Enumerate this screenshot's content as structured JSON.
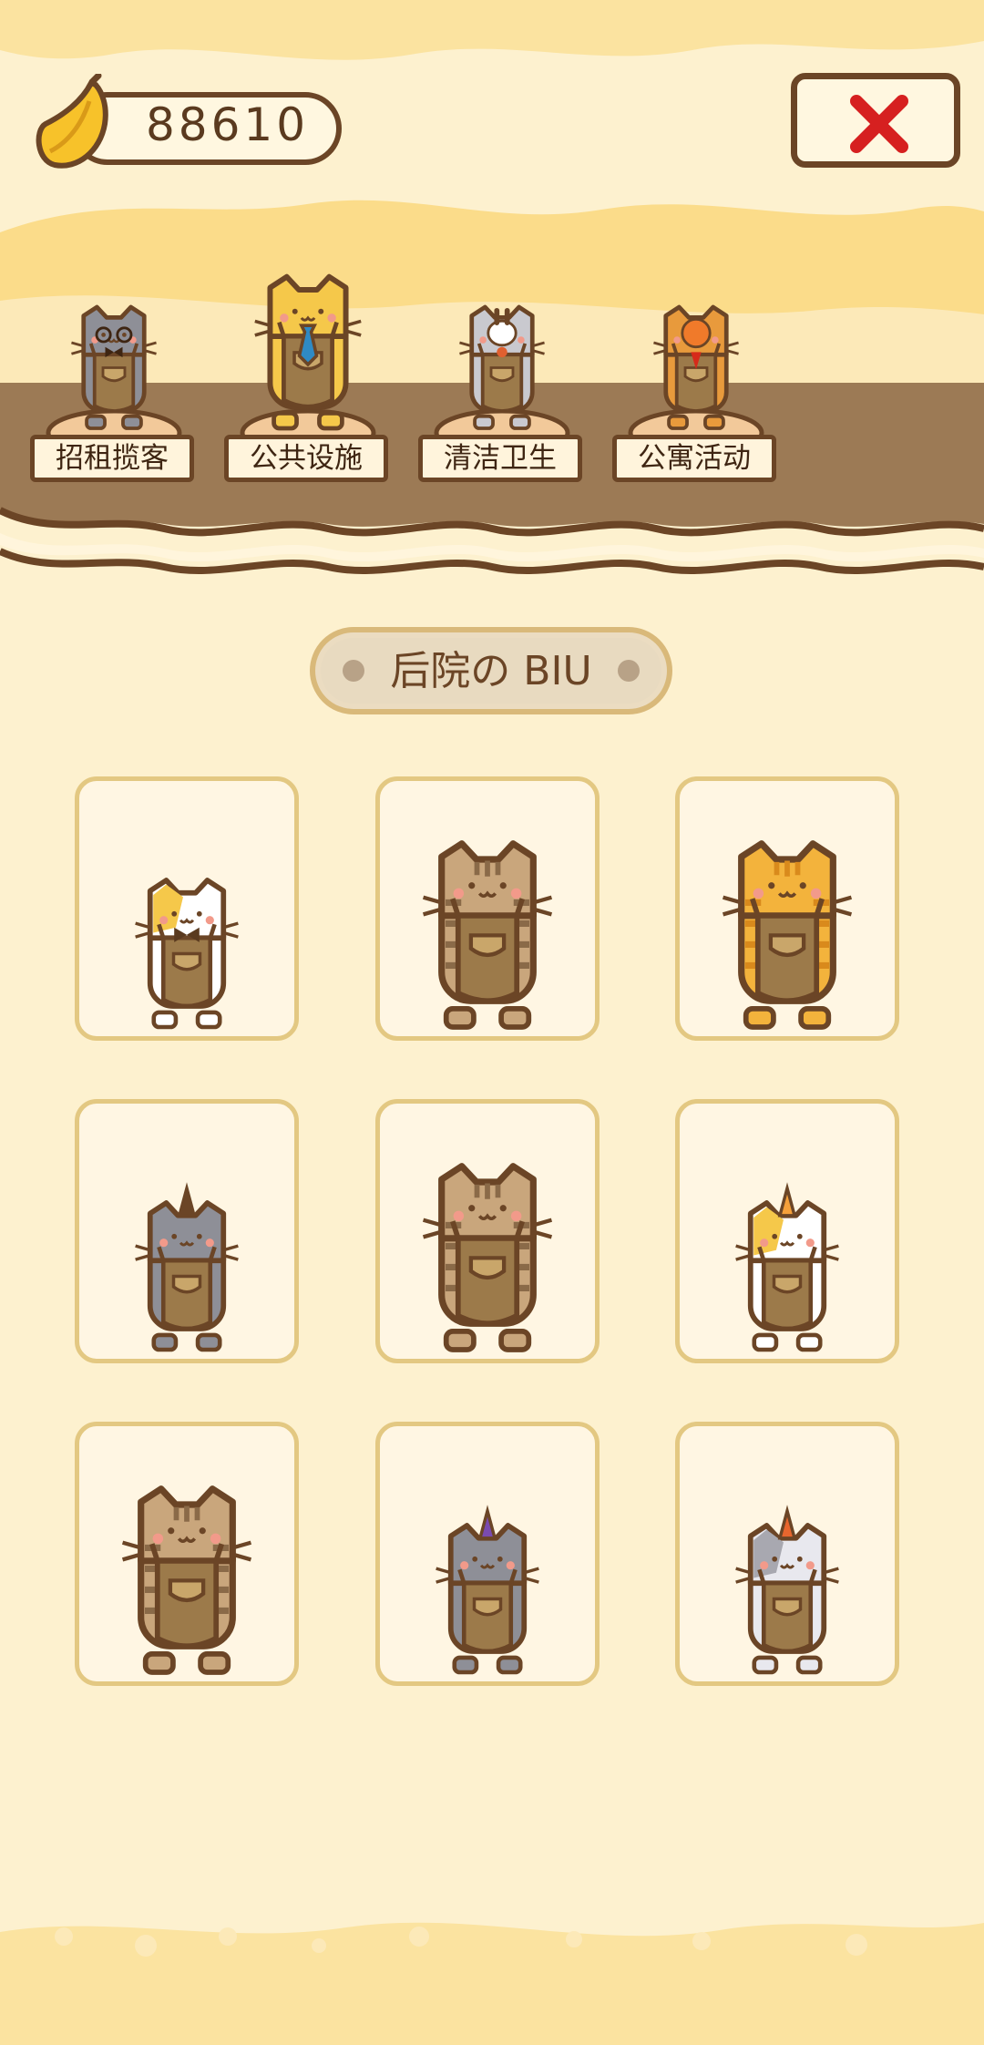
{
  "header": {
    "currency_amount": "88610",
    "currency_icon": "banana-icon",
    "close_icon": "close-icon"
  },
  "departments": [
    {
      "label": "招租揽客",
      "cat": "gray-cat-glasses"
    },
    {
      "label": "公共设施",
      "cat": "yellow-cat-tie"
    },
    {
      "label": "清洁卫生",
      "cat": "white-rabbit-cat"
    },
    {
      "label": "公寓活动",
      "cat": "orange-chick-cat"
    }
  ],
  "section": {
    "title": "后院の BIU"
  },
  "cats": [
    {
      "name": "calico-cat-bowtie"
    },
    {
      "name": "brown-tabby-cat"
    },
    {
      "name": "orange-tabby-cat"
    },
    {
      "name": "gray-cat-horn"
    },
    {
      "name": "brown-tabby-cat"
    },
    {
      "name": "calico-cat-unicorn"
    },
    {
      "name": "brown-tabby-cat"
    },
    {
      "name": "gray-cat-purple-horn"
    },
    {
      "name": "silver-cat-unicorn"
    }
  ],
  "colors": {
    "background": "#fdf1cf",
    "outline": "#6b4526",
    "stage": "#9c7a55",
    "card_border": "#e3c882",
    "close_x": "#d62020"
  }
}
